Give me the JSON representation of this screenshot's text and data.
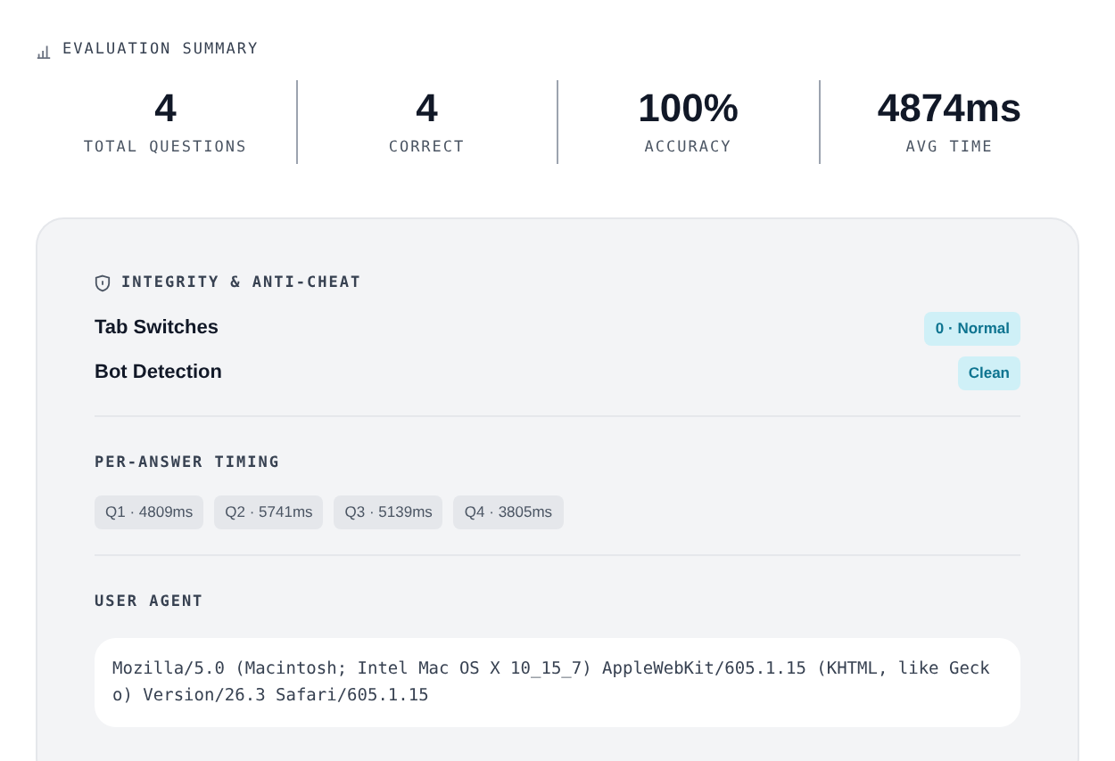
{
  "summary": {
    "title": "EVALUATION SUMMARY",
    "stats": [
      {
        "value": "4",
        "label": "TOTAL QUESTIONS"
      },
      {
        "value": "4",
        "label": "CORRECT"
      },
      {
        "value": "100%",
        "label": "ACCURACY"
      },
      {
        "value": "4874ms",
        "label": "AVG TIME"
      }
    ]
  },
  "integrity": {
    "title": "INTEGRITY & ANTI-CHEAT",
    "rows": [
      {
        "label": "Tab Switches",
        "badge": "0 · Normal"
      },
      {
        "label": "Bot Detection",
        "badge": "Clean"
      }
    ]
  },
  "timing": {
    "title": "PER-ANSWER TIMING",
    "chips": [
      "Q1 · 4809ms",
      "Q2 · 5741ms",
      "Q3 · 5139ms",
      "Q4 · 3805ms"
    ]
  },
  "user_agent": {
    "title": "USER AGENT",
    "value": "Mozilla/5.0 (Macintosh; Intel Mac OS X 10_15_7) AppleWebKit/605.1.15 (KHTML, like Gecko) Version/26.3 Safari/605.1.15"
  }
}
